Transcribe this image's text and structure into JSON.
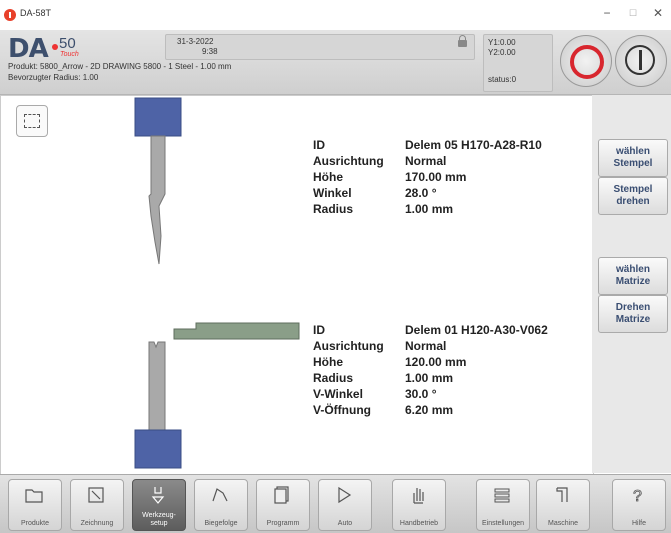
{
  "window": {
    "title": "DA-58T",
    "minimize": "−",
    "maximize": "☐",
    "close": "✕"
  },
  "header": {
    "logo": "DA",
    "logo_number": "50",
    "logo_touch": "Touch",
    "date": "31-3-2022",
    "time": "9:38",
    "product": "Produkt: 5800_Arrow - 2D DRAWING 5800 - 1 Steel - 1.00 mm",
    "radius": "Bevorzugter Radius: 1.00",
    "y1": "Y1:0.00",
    "y2": "Y2:0.00",
    "status": "status:0",
    "colors": {
      "stop": "#d8262e",
      "brand": "#3d4f6d"
    }
  },
  "punch": {
    "id_label": "ID",
    "id_value": "Delem 05 H170-A28-R10",
    "orientation_label": "Ausrichtung",
    "orientation_value": "Normal",
    "height_label": "Höhe",
    "height_value": "170.00 mm",
    "angle_label": "Winkel",
    "angle_value": "28.0 °",
    "radius_label": "Radius",
    "radius_value": "1.00 mm"
  },
  "die": {
    "id_label": "ID",
    "id_value": "Delem 01 H120-A30-V062",
    "orientation_label": "Ausrichtung",
    "orientation_value": "Normal",
    "height_label": "Höhe",
    "height_value": "120.00 mm",
    "radius_label": "Radius",
    "radius_value": "1.00 mm",
    "vangle_label": "V-Winkel",
    "vangle_value": "30.0 °",
    "vopening_label": "V-Öffnung",
    "vopening_value": "6.20 mm"
  },
  "sidebar": {
    "select_punch": "wählen\nStempel",
    "rotate_punch": "Stempel\ndrehen",
    "select_die": "wählen\nMatrize",
    "rotate_die": "Drehen\nMatrize"
  },
  "tabs": [
    {
      "label": "Produkte",
      "icon": "folder-icon"
    },
    {
      "label": "Zeichnung",
      "icon": "pencil-icon"
    },
    {
      "label": "Werkzeug-\nsetup",
      "icon": "tool-icon"
    },
    {
      "label": "Biegefolge",
      "icon": "bend-icon"
    },
    {
      "label": "Programm",
      "icon": "program-icon"
    },
    {
      "label": "Auto",
      "icon": "play-icon"
    },
    {
      "label": "Handbetrieb",
      "icon": "hand-icon"
    },
    {
      "label": "Einstellungen",
      "icon": "settings-list-icon"
    },
    {
      "label": "Maschine",
      "icon": "machine-icon"
    },
    {
      "label": "Hilfe",
      "icon": "help-icon"
    }
  ]
}
